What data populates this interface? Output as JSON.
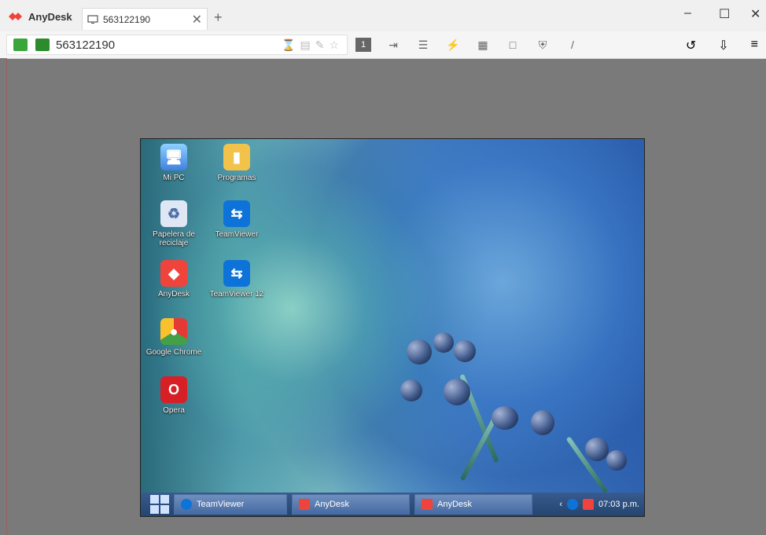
{
  "app": {
    "brand": "AnyDesk",
    "tab": {
      "title": "563122190"
    },
    "new_tab": "+",
    "window_controls": [
      "–",
      "☐",
      "✕"
    ]
  },
  "toolbar": {
    "address": "563122190",
    "address_icons": [
      "⌛",
      "▤",
      "✎",
      "☆"
    ],
    "icons": [
      "1",
      "⇥",
      "☰",
      "⚡",
      "▦",
      "□",
      "⛨",
      "/"
    ],
    "right_icons": [
      "↺",
      "⇩",
      "≡"
    ]
  },
  "remote_desktop": {
    "desktop_icons": [
      {
        "label": "Mi PC",
        "icon": "pc-icon",
        "color": "#5ba3ff"
      },
      {
        "label": "Programas",
        "icon": "folder-icon",
        "color": "#f2c24b"
      },
      {
        "label": "Papelera de reciclaje",
        "icon": "recycle-bin-icon",
        "color": "#dfe6f4"
      },
      {
        "label": "TeamViewer",
        "icon": "teamviewer-icon",
        "color": "#0e73d8"
      },
      {
        "label": "AnyDesk",
        "icon": "anydesk-icon",
        "color": "#ef443b"
      },
      {
        "label": "TeamViewer 12",
        "icon": "teamviewer-icon",
        "color": "#0e73d8"
      },
      {
        "label": "Google Chrome",
        "icon": "chrome-icon",
        "color": "#4caf50"
      },
      {
        "label": "Opera",
        "icon": "opera-icon",
        "color": "#d71f26"
      }
    ],
    "taskbar": {
      "items": [
        {
          "label": "TeamViewer",
          "icon": "teamviewer-icon"
        },
        {
          "label": "AnyDesk",
          "icon": "anydesk-icon"
        },
        {
          "label": "AnyDesk",
          "icon": "anydesk-icon"
        }
      ],
      "time": "07:03 p.m."
    }
  },
  "colors": {
    "brand_red": "#ef443b",
    "accent_green": "#3aa53a",
    "frame_gray": "#7a7a7a"
  }
}
